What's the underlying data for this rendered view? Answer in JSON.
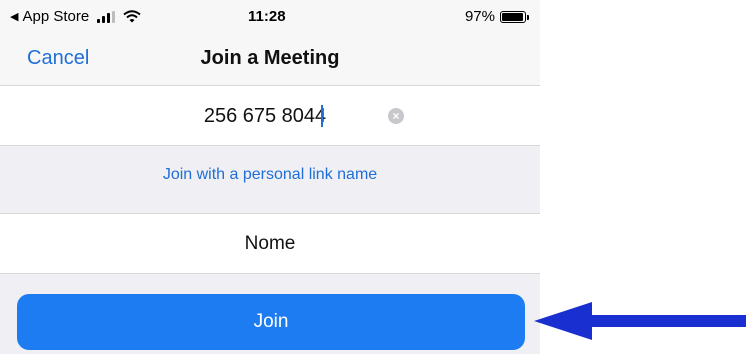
{
  "status_bar": {
    "back_app": "App Store",
    "time": "11:28",
    "battery": "97%",
    "battery_level": 0.97,
    "icons": [
      "back-triangle-icon",
      "signal-icon",
      "wifi-icon",
      "battery-icon"
    ]
  },
  "nav": {
    "cancel_label": "Cancel",
    "title": "Join a Meeting"
  },
  "meeting_id": {
    "value": "256 675 8044"
  },
  "personal_link": {
    "label": "Join with a personal link name"
  },
  "name_field": {
    "value": "Nome"
  },
  "join_button": {
    "label": "Join"
  },
  "colors": {
    "accent": "#1f6fd6",
    "join_button": "#1e7cf2",
    "arrow": "#1a2fd0",
    "background": "#efeff4"
  }
}
